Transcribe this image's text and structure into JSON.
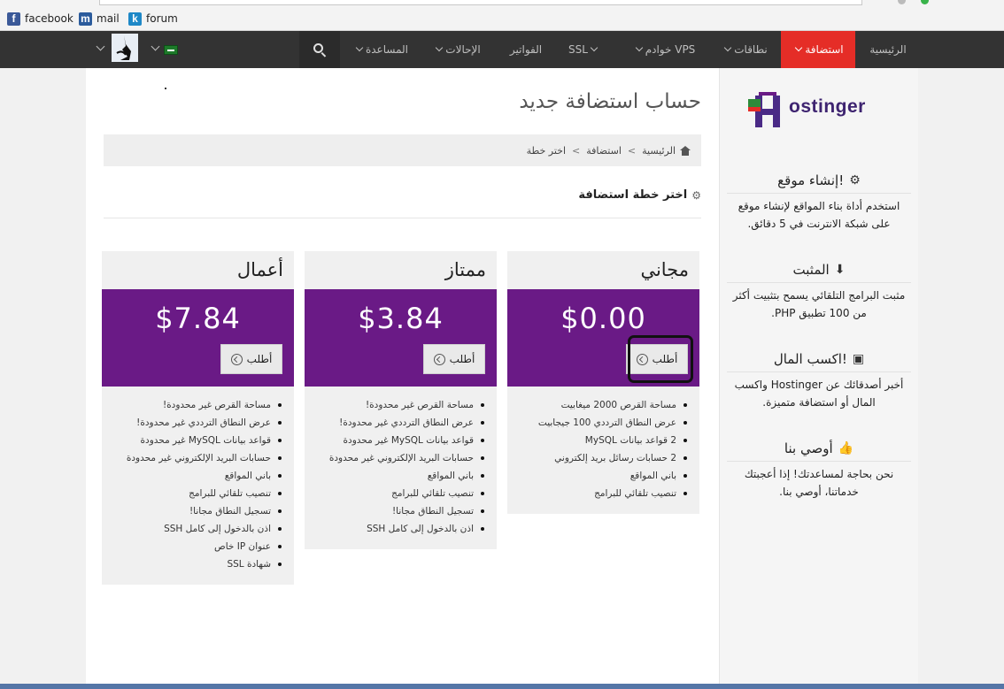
{
  "bookmarks": [
    {
      "label": "facebook",
      "icon": "facebook-icon"
    },
    {
      "label": "mail",
      "icon": "mail-icon"
    },
    {
      "label": "forum",
      "icon": "forum-icon"
    }
  ],
  "nav": {
    "items": [
      {
        "label": "الرئيسية",
        "active": false,
        "dropdown": false
      },
      {
        "label": "استضافة",
        "active": true,
        "dropdown": true
      },
      {
        "label": "نطاقات",
        "active": false,
        "dropdown": true
      },
      {
        "label": "خوادم VPS",
        "active": false,
        "dropdown": true
      },
      {
        "label": "SSL",
        "active": false,
        "dropdown": true
      },
      {
        "label": "الفواتير",
        "active": false,
        "dropdown": false
      },
      {
        "label": "الإحالات",
        "active": false,
        "dropdown": true
      },
      {
        "label": "المساعدة",
        "active": false,
        "dropdown": true
      }
    ],
    "search_icon": "search-icon"
  },
  "page": {
    "title": "حساب استضافة جديد",
    "breadcrumb": [
      "الرئيسية",
      "استضافة",
      "اختر خطة"
    ],
    "section_heading": "اختر خطة استضافة"
  },
  "plans": [
    {
      "name": "مجاني",
      "price": "$0.00",
      "button": "أطلب",
      "features": [
        "مساحة القرص 2000 ميغابيت",
        "عرض النطاق الترددي 100 جيجابيت",
        "2 قواعد بيانات MySQL",
        "2 حسابات رسائل بريد إلكتروني",
        "باني المواقع",
        "تنصيب تلقائي للبرامج"
      ]
    },
    {
      "name": "ممتاز",
      "price": "$3.84",
      "button": "أطلب",
      "features": [
        "مساحة القرص غير محدودة!",
        "عرض النطاق الترددي غير محدودة!",
        "قواعد بيانات MySQL غير محدودة",
        "حسابات البريد الإلكتروني غير محدودة",
        "باني المواقع",
        "تنصيب تلقائي للبرامج",
        "تسجيل النطاق مجانا!",
        "اذن بالدخول إلى كامل SSH"
      ]
    },
    {
      "name": "أعمال",
      "price": "$7.84",
      "button": "أطلب",
      "features": [
        "مساحة القرص غير محدودة!",
        "عرض النطاق الترددي غير محدودة!",
        "قواعد بيانات MySQL غير محدودة",
        "حسابات البريد الإلكتروني غير محدودة",
        "باني المواقع",
        "تنصيب تلقائي للبرامج",
        "تسجيل النطاق مجانا!",
        "اذن بالدخول إلى كامل SSH",
        "عنوان IP خاص",
        "شهادة SSL"
      ]
    }
  ],
  "sidebar": {
    "logo_text": "ostinger",
    "sections": [
      {
        "title": "إنشاء موقع!",
        "icon": "gears-icon",
        "text": "استخدم أداة بناء المواقع لإنشاء موقع على شبكة الانترنت في 5 دقائق."
      },
      {
        "title": "المثبت",
        "icon": "download-icon",
        "text": "مثبت البرامج التلقائي يسمح بتثبيت أكثر من 100 تطبيق PHP."
      },
      {
        "title": "اكسب المال!",
        "icon": "money-icon",
        "text": "أخبر أصدقائك عن Hostinger واكسب المال أو استضافة متميزة."
      },
      {
        "title": "أوصي بنا",
        "icon": "thumbs-up-icon",
        "text": "نحن بحاجة لمساعدتك! إذا أعجبتك خدماتنا، أوصي بنا."
      }
    ]
  },
  "colors": {
    "navbar": "#333333",
    "nav_active": "#e52d27",
    "plan_purple": "#6a1a86"
  }
}
